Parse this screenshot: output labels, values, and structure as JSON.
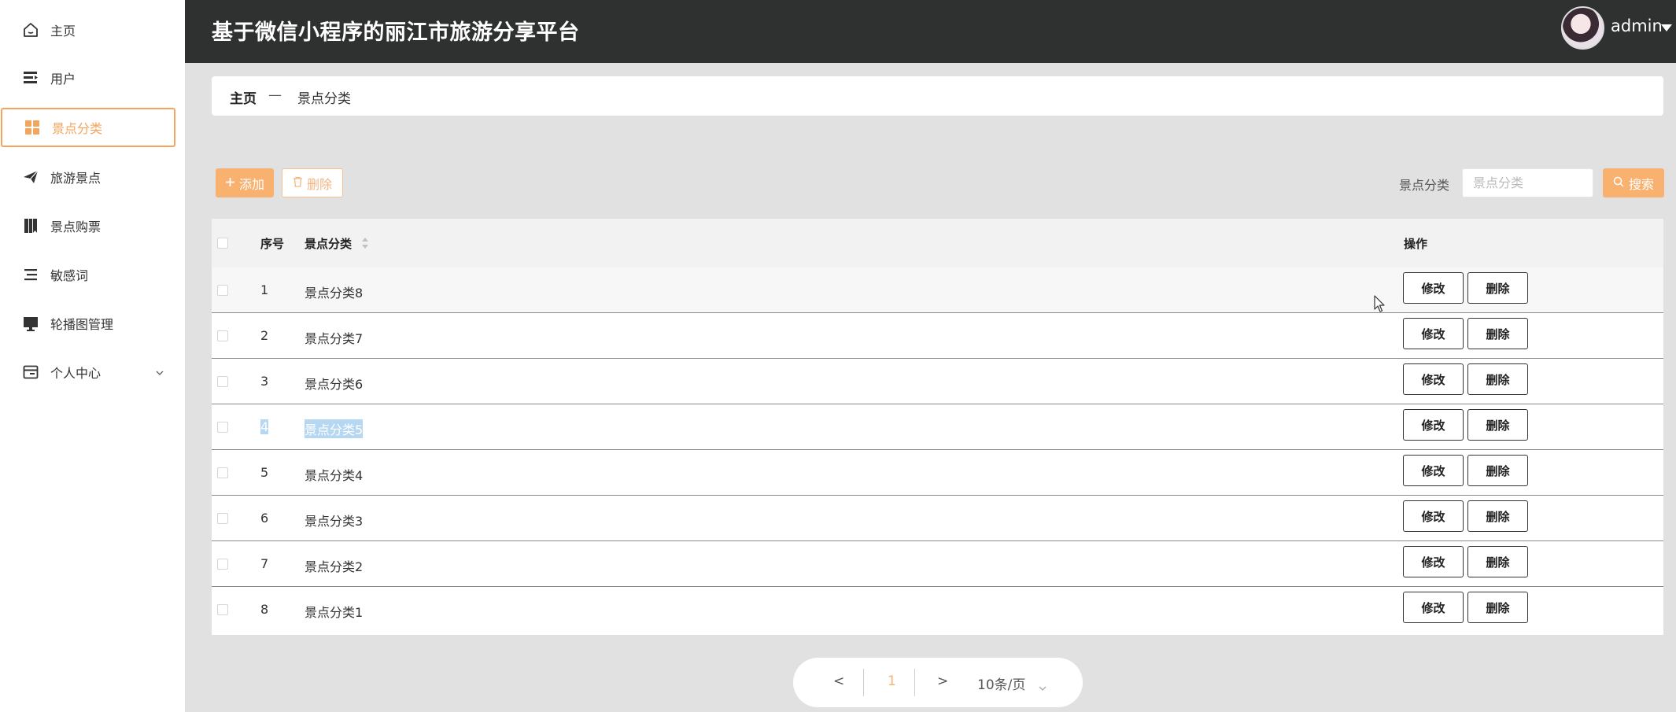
{
  "header": {
    "title": "基于微信小程序的丽江市旅游分享平台",
    "username": "admin"
  },
  "sidebar": {
    "items": [
      {
        "label": "主页",
        "icon": "home-icon"
      },
      {
        "label": "用户",
        "icon": "user-list-icon"
      },
      {
        "label": "景点分类",
        "icon": "grid-icon",
        "active": true
      },
      {
        "label": "旅游景点",
        "icon": "paper-plane-icon"
      },
      {
        "label": "景点购票",
        "icon": "book-icon"
      },
      {
        "label": "敏感词",
        "icon": "list-icon"
      },
      {
        "label": "轮播图管理",
        "icon": "monitor-icon"
      },
      {
        "label": "个人中心",
        "icon": "card-icon",
        "expandable": true
      }
    ]
  },
  "breadcrumb": {
    "home": "主页",
    "separator": "—",
    "current": "景点分类"
  },
  "toolbar": {
    "add_label": "添加",
    "delete_label": "删除",
    "search_label": "景点分类",
    "search_placeholder": "景点分类",
    "search_button": "搜索"
  },
  "table": {
    "headers": {
      "index": "序号",
      "category": "景点分类",
      "actions": "操作"
    },
    "rows": [
      {
        "index": "1",
        "category": "景点分类8"
      },
      {
        "index": "2",
        "category": "景点分类7"
      },
      {
        "index": "3",
        "category": "景点分类6"
      },
      {
        "index": "4",
        "category": "景点分类5",
        "selected": true
      },
      {
        "index": "5",
        "category": "景点分类4"
      },
      {
        "index": "6",
        "category": "景点分类3"
      },
      {
        "index": "7",
        "category": "景点分类2"
      },
      {
        "index": "8",
        "category": "景点分类1"
      }
    ],
    "edit_label": "修改",
    "remove_label": "删除"
  },
  "pagination": {
    "prev": "<",
    "current_page": "1",
    "next": ">",
    "page_size": "10条/页"
  },
  "colors": {
    "accent": "#f9b170",
    "header_bg": "#2f3130",
    "page_bg": "#e1e1e1"
  }
}
